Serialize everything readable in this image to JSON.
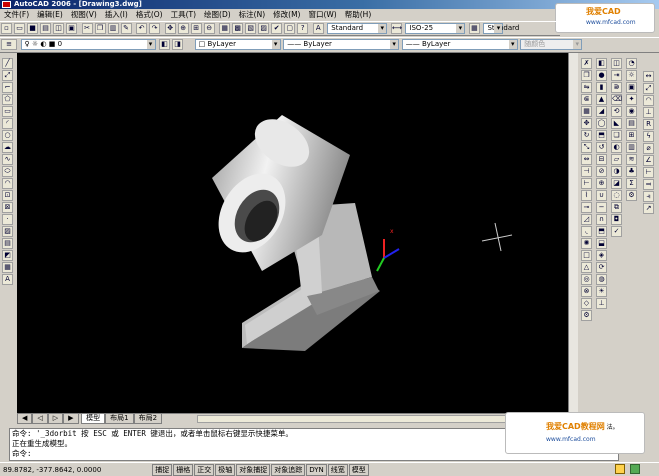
{
  "window": {
    "title": "AutoCAD 2006 - [Drawing3.dwg]"
  },
  "menu": [
    "文件(F)",
    "编辑(E)",
    "视图(V)",
    "插入(I)",
    "格式(O)",
    "工具(T)",
    "绘图(D)",
    "标注(N)",
    "修改(M)",
    "窗口(W)",
    "帮助(H)"
  ],
  "toolbar": {
    "text_style": "Standard",
    "dim_style": "ISO-25",
    "table_style": "Standard",
    "layer": "0",
    "color": "ByLayer",
    "linetype": "ByLayer",
    "lineweight": "ByLayer",
    "plotstyle": "随颜色"
  },
  "tabs": [
    "模型",
    "布局1",
    "布局2"
  ],
  "command": {
    "line1": "命令: '_3dorbit 按 ESC 或 ENTER 键退出，或者单击鼠标右键显示快捷菜单。",
    "line2": "正在重生成模型。",
    "prompt": "命令:",
    "tail": "法。"
  },
  "status": {
    "coords": "89.8782, -377.8642, 0.0000",
    "buttons": [
      "捕捉",
      "栅格",
      "正交",
      "极轴",
      "对象捕捉",
      "对象追踪",
      "DYN",
      "线宽",
      "模型"
    ]
  },
  "watermark": {
    "brand": "我爱CAD",
    "brand2": "我爱CAD教程网",
    "url": "www.mfcad.com"
  },
  "colors": {
    "canvas": "#000000",
    "title_start": "#0a246a",
    "title_end": "#a6caf0"
  }
}
